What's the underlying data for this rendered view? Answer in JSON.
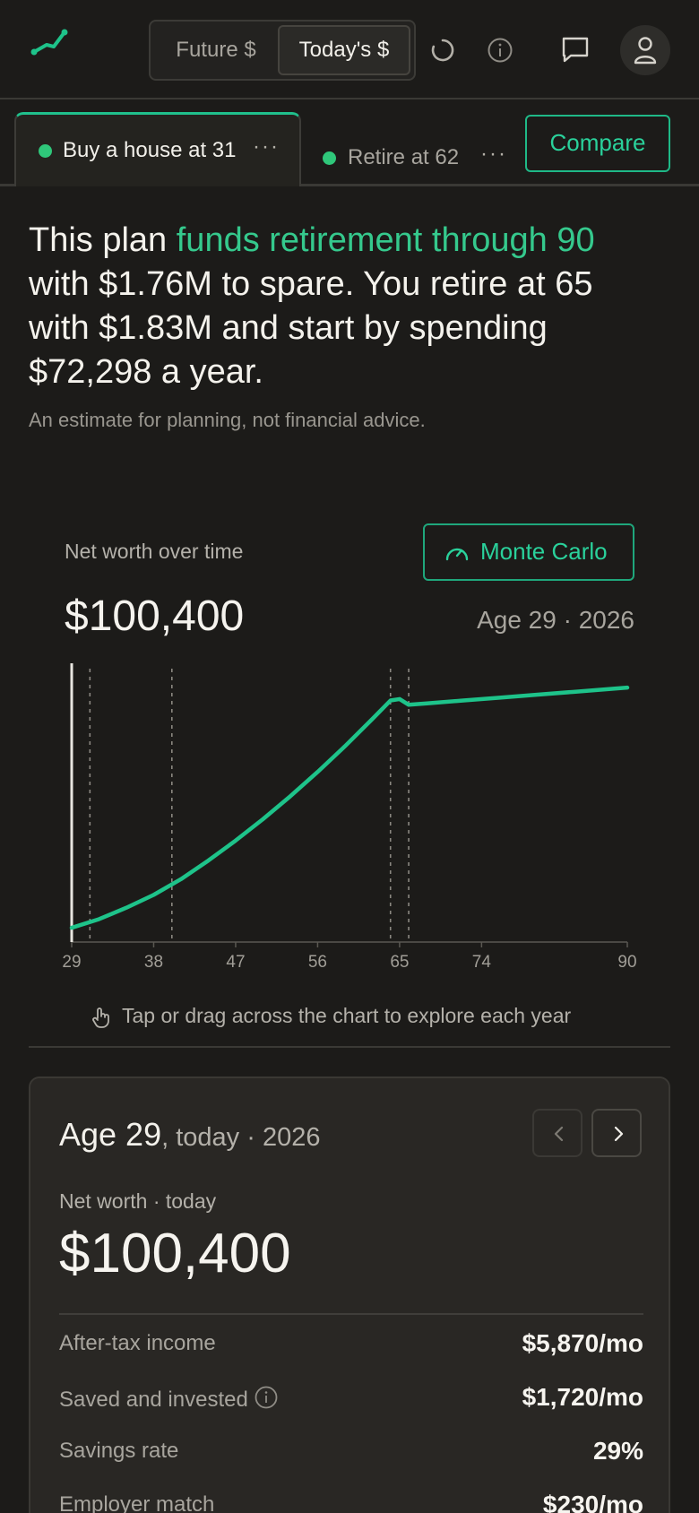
{
  "header": {
    "toggle": {
      "future_label": "Future $",
      "today_label": "Today's $"
    }
  },
  "tabs": [
    {
      "label": "Buy a house at 31",
      "more": "···"
    },
    {
      "label": "Retire at 62",
      "more": "···"
    }
  ],
  "compare_label": "Compare",
  "summary": {
    "part1": "This plan ",
    "highlight": "funds retirement through 90",
    "part2": " with $1.76M to spare. You retire at 65 with $1.83M and start by spending $72,298 a year."
  },
  "disclaimer": "An estimate for planning, not financial advice.",
  "chart_header": {
    "title": "Net worth over time",
    "monte_carlo_label": "Monte Carlo",
    "value": "$100,400",
    "age_label": "Age 29 · 2026"
  },
  "chart_data": {
    "type": "line",
    "xlim": [
      29,
      90
    ],
    "x_ticks": [
      "29",
      "38",
      "47",
      "56",
      "65",
      "74",
      "90"
    ],
    "series": [
      {
        "x": [
          29,
          32,
          35,
          38,
          41,
          44,
          47,
          50,
          53,
          56,
          59,
          62,
          64,
          65,
          66,
          68,
          72,
          76,
          80,
          84,
          88,
          90
        ],
        "y": [
          0.1,
          0.16,
          0.24,
          0.33,
          0.44,
          0.57,
          0.71,
          0.86,
          1.02,
          1.19,
          1.37,
          1.56,
          1.69,
          1.7,
          1.66,
          1.67,
          1.69,
          1.71,
          1.73,
          1.75,
          1.77,
          1.78
        ]
      }
    ],
    "milestones": [
      31,
      40,
      64,
      66
    ],
    "selected_x": 29,
    "grid": false,
    "line_color": "#1ec38a"
  },
  "hint": "Tap or drag across the chart to explore each year",
  "card": {
    "age": "Age 29",
    "age_suffix": ", today · 2026",
    "sub": "Net worth · today",
    "value": "$100,400",
    "rows": [
      {
        "label": "After-tax income",
        "value": "$5,870/mo"
      },
      {
        "label": "Saved and invested",
        "value": "$1,720/mo"
      },
      {
        "label": "Savings rate",
        "value": "29%"
      },
      {
        "label": "Employer match",
        "value": "$230/mo"
      }
    ]
  }
}
